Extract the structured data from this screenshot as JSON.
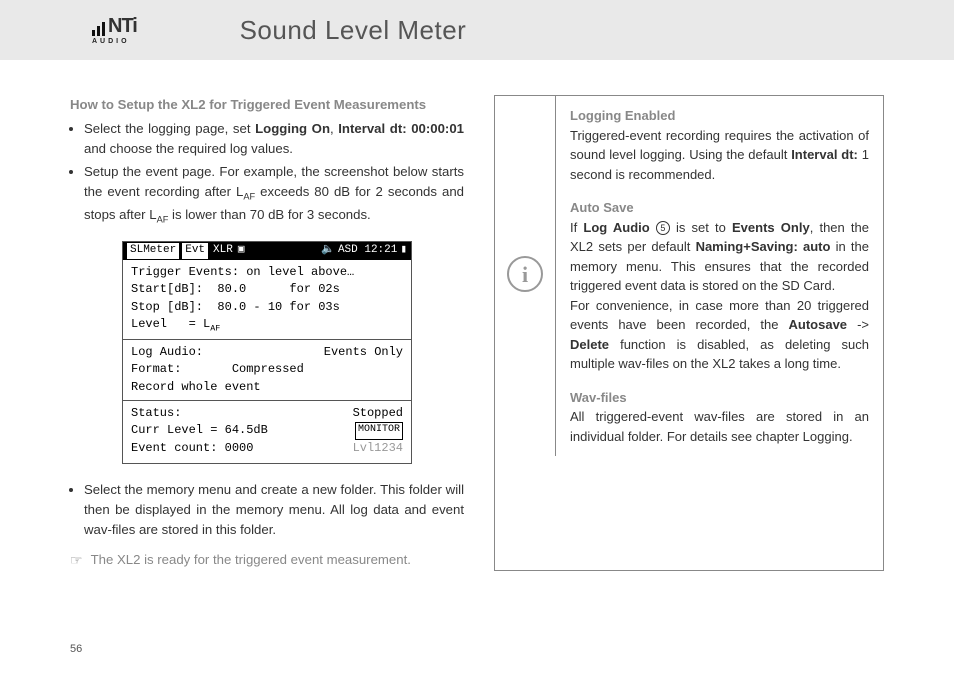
{
  "logo": {
    "brand": "NTi",
    "sub": "AUDIO"
  },
  "page_title": "Sound Level Meter",
  "page_number": "56",
  "left": {
    "heading": "How to Setup the XL2 for Triggered Event Measurements",
    "b1_pre": "Select the logging page, set ",
    "b1_b1": "Logging On",
    "b1_mid": ", ",
    "b1_b2": "Interval dt: 00:00:01",
    "b1_post": " and choose the required log values.",
    "b2_pre": "Setup the event page. For example, the screenshot below starts the event recording after L",
    "b2_sub1": "AF",
    "b2_mid": " exceeds 80 dB for 2 seconds and stops after L",
    "b2_sub2": "AF",
    "b2_post": " is lower than 70 dB for 3 seconds.",
    "b3": "Select the memory menu and create a new folder. This folder will then be displayed in the memory menu. All log data and event wav-files are stored in this folder.",
    "ready": "The XL2 is ready for the triggered event measurement."
  },
  "screenshot": {
    "tab1": "SLMeter",
    "tab2": "Evt",
    "tab3": "XLR",
    "sd": "▣",
    "speaker": "🔈",
    "asd": "ASD 12:21",
    "batt": "▮",
    "trig_header": "Trigger Events: on level above…",
    "start": "Start[dB]:  80.0      for 02s",
    "stop": "Stop [dB]:  80.0 - 10 for 03s",
    "level_label": "Level   = L",
    "level_sub": "AF",
    "log_label": "Log Audio:",
    "log_val": "Events Only",
    "format": "Format:       Compressed",
    "record_whole": "Record whole event",
    "status_label": "Status:",
    "status_val": "Stopped",
    "curr": "Curr Level =  64.5dB",
    "monitor": "MONITOR",
    "evcount": "Event count:  0000",
    "lvl": "Lvl1234"
  },
  "right": {
    "h1": "Logging Enabled",
    "p1_pre": "Triggered-event recording requires the activation of sound level logging. Using the default ",
    "p1_b": "Interval dt:",
    "p1_post": " 1 second is recommended.",
    "h2": "Auto Save",
    "p2_pre": "If ",
    "p2_b1": "Log Audio",
    "p2_circ": "5",
    "p2_mid1": " is set to ",
    "p2_b2": "Events Only",
    "p2_mid2": ", then the XL2 sets per default ",
    "p2_b3": "Naming+Saving: auto",
    "p2_post": " in the memory menu. This ensures that the recorded triggered event data is stored on the SD Card.",
    "p3_pre": "For convenience, in case more than 20 triggered events have been recorded, the ",
    "p3_b1": "Autosave",
    "p3_mid": " -> ",
    "p3_b2": "Delete",
    "p3_post": " function is disabled, as deleting such multiple wav-files on the XL2 takes a long time.",
    "h3": "Wav-files",
    "p4": "All triggered-event wav-files are stored in an individual folder. For details see chapter Logging."
  }
}
